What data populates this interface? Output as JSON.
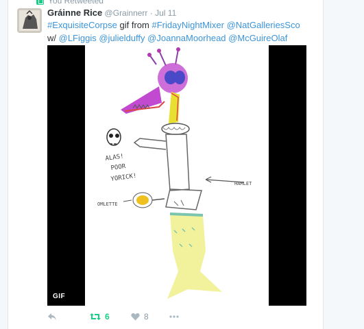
{
  "context": {
    "label": "You Retweeted"
  },
  "tweet": {
    "fullname": "Gráinne Rice",
    "username": "@Grainnerr",
    "separator": "·",
    "timestamp": "Jul 11",
    "text": {
      "hashtag": "#ExquisiteCorpse",
      "plain1": " gif from ",
      "mention1": "#FridayNightMixer",
      "space1": " ",
      "mention2": "@NatGalleriesSco",
      "plain2": " w/ ",
      "mention3": "@LFiggis",
      "space2": " ",
      "mention4": "@julielduffy",
      "space3": " ",
      "mention5": "@JoannaMoorhead",
      "space4": " ",
      "mention6": "@McGuireOlaf"
    },
    "media": {
      "badge": "GIF",
      "drawing_labels": {
        "alas": "ALAS!",
        "poor": "POOR",
        "yorick": "YORICK!",
        "hamlet": "HAMLET",
        "omlette": "OMLETTE"
      }
    },
    "actions": {
      "retweet_count": "6",
      "like_count": "8"
    }
  },
  "colors": {
    "link": "#3b94d9",
    "retweet_active": "#19cf86",
    "muted": "#8899a6"
  },
  "icons": [
    "retweet-context-icon",
    "reply-icon",
    "retweet-icon",
    "heart-icon",
    "more-icon"
  ]
}
